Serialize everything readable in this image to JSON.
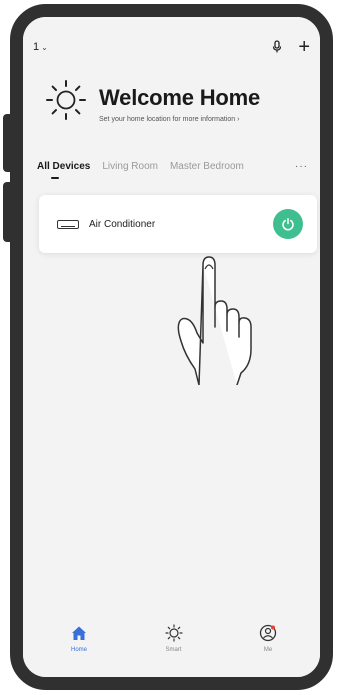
{
  "status_bar": {
    "home_name": "1",
    "home_chevron": "⌄"
  },
  "welcome": {
    "title": "Welcome Home",
    "subtitle": "Set your home location for more information  ›"
  },
  "tabs": [
    {
      "label": "All Devices",
      "active": true
    },
    {
      "label": "Living Room",
      "active": false
    },
    {
      "label": "Master Bedroom",
      "active": false
    },
    {
      "label": "···",
      "active": false
    }
  ],
  "device": {
    "name": "Air Conditioner",
    "power_color": "#3fbf8f"
  },
  "bottom_nav": {
    "items": [
      {
        "label": "Home",
        "icon": "home-icon",
        "active": true
      },
      {
        "label": "Smart",
        "icon": "smart-sun-icon",
        "active": false
      },
      {
        "label": "Me",
        "icon": "me-icon",
        "active": false
      }
    ]
  },
  "colors": {
    "frame": "#303030",
    "accent_blue": "#3a6fd8",
    "power_green": "#3fbf8f",
    "screen_bg": "#f3f3f3"
  }
}
